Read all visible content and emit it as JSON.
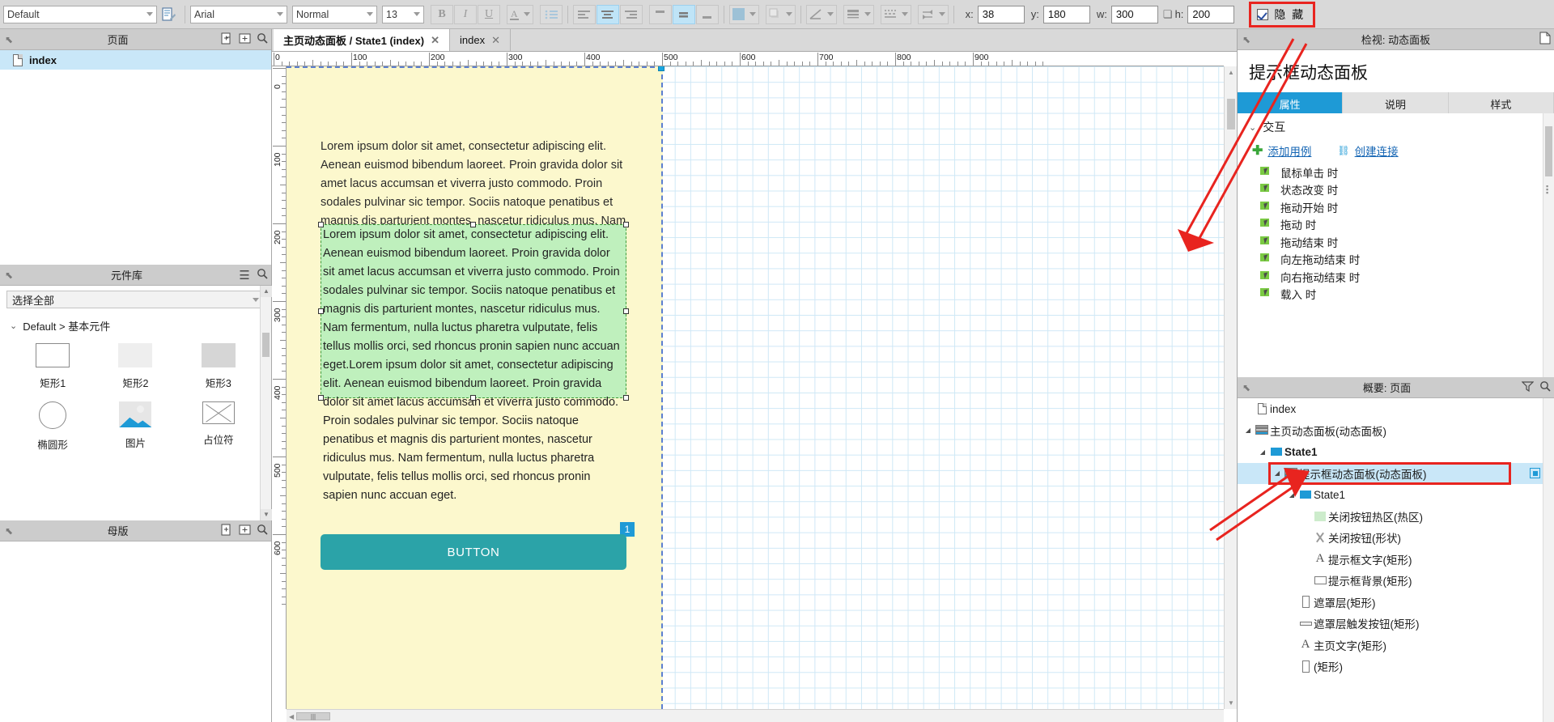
{
  "toolbar": {
    "style_select": "Default",
    "style_icon": "style-doc-icon",
    "font_select": "Arial",
    "weight_select": "Normal",
    "size_select": "13",
    "bold_label": "B",
    "italic_label": "I",
    "underline_label": "U",
    "font_color_label": "A",
    "bullet_icon": "bullet-list-icon",
    "align_left_icon": "align-left-icon",
    "align_center_icon": "align-center-icon",
    "align_right_icon": "align-right-icon",
    "valign_top_icon": "valign-top-icon",
    "valign_middle_icon": "valign-middle-icon",
    "valign_bottom_icon": "valign-bottom-icon",
    "fill_icon": "fill-color-icon",
    "shadow_icon": "shadow-icon",
    "line_icon": "line-style-icon",
    "line_width_icon": "line-width-icon",
    "dash_icon": "line-dash-icon",
    "arrow_icon": "arrow-style-icon",
    "x_label": "x:",
    "x_value": "38",
    "y_label": "y:",
    "y_value": "180",
    "w_label": "w:",
    "w_value": "300",
    "h_label": "h:",
    "h_value": "200",
    "lock_icon": "lock-aspect-icon",
    "hide_label": "隐 藏",
    "hide_checked": true,
    "accent_red": "#e8241f"
  },
  "pages_panel": {
    "title": "页面",
    "icons": [
      "add-page-icon",
      "add-folder-icon",
      "search-icon"
    ],
    "items": [
      {
        "label": "index",
        "icon": "page-file-icon",
        "selected": true
      }
    ]
  },
  "library_panel": {
    "title": "元件库",
    "icons": [
      "menu-icon",
      "search-icon"
    ],
    "selector_value": "选择全部",
    "group_label": "Default > 基本元件",
    "items": [
      {
        "label": "矩形1",
        "icon": "rectangle-outline-icon"
      },
      {
        "label": "矩形2",
        "icon": "rectangle-light-icon"
      },
      {
        "label": "矩形3",
        "icon": "rectangle-gray-icon"
      },
      {
        "label": "椭圆形",
        "icon": "ellipse-icon"
      },
      {
        "label": "图片",
        "icon": "image-icon"
      },
      {
        "label": "占位符",
        "icon": "placeholder-icon"
      }
    ]
  },
  "masters_panel": {
    "title": "母版",
    "icons": [
      "add-master-icon",
      "add-folder-icon",
      "search-icon"
    ]
  },
  "tabs": [
    {
      "label": "主页动态面板 / State1 (index)",
      "active": true,
      "closable": true,
      "close_label": "✕"
    },
    {
      "label": "index",
      "active": false,
      "closable": true,
      "close_label": "✕"
    }
  ],
  "canvas": {
    "h_ruler_labels": [
      "0",
      "100",
      "200",
      "300",
      "400",
      "500",
      "600",
      "700",
      "800",
      "900"
    ],
    "v_ruler_labels": [
      "0",
      "100",
      "200",
      "300",
      "400",
      "500",
      "600"
    ],
    "main_text": "Lorem ipsum dolor sit amet, consectetur adipiscing elit. Aenean euismod bibendum laoreet. Proin gravida dolor sit amet lacus accumsan et viverra justo commodo. Proin sodales pulvinar sic tempor. Sociis natoque penatibus et magnis dis parturient montes, nascetur ridiculus mus. Nam fermentum, nulla luctus pharetra vulputate, felis tellus mollis orci, sed rhoncus pronin sapien nunc accuan eget",
    "tip_text": "Lorem ipsum dolor sit amet, consectetur adipiscing elit. Aenean euismod bibendum laoreet. Proin gravida dolor sit amet lacus accumsan et viverra justo commodo. Proin sodales pulvinar sic tempor. Sociis natoque penatibus et magnis dis parturient montes, nascetur ridiculus mus. Nam fermentum, nulla luctus pharetra vulputate, felis tellus mollis orci, sed rhoncus pronin sapien nunc accuan eget.Lorem ipsum dolor sit amet, consectetur adipiscing elit. Aenean euismod bibendum laoreet. Proin gravida dolor sit amet lacus accumsan et viverra justo commodo. Proin sodales pulvinar sic tempor. Sociis natoque penatibus et magnis dis parturient montes, nascetur ridiculus mus. Nam fermentum, nulla luctus pharetra vulputate, felis tellus mollis orci, sed rhoncus pronin sapien nunc accuan eget.",
    "button_label": "BUTTON",
    "button_color": "#2ba3a8",
    "badge_label": "1",
    "page_bg": "#fcf8cd",
    "tip_bg": "#bff0bd"
  },
  "inspector": {
    "header_title": "检视: 动态面板",
    "header_icon": "page-note-icon",
    "object_name": "提示框动态面板",
    "tabs": [
      {
        "label": "属性",
        "active": true
      },
      {
        "label": "说明",
        "active": false
      },
      {
        "label": "样式",
        "active": false
      }
    ],
    "section_label": "交互",
    "add_case_label": "添加用例",
    "create_link_label": "创建连接",
    "events": [
      "鼠标单击 时",
      "状态改变 时",
      "拖动开始 时",
      "拖动 时",
      "拖动结束 时",
      "向左拖动结束 时",
      "向右拖动结束 时",
      "载入 时"
    ]
  },
  "outline": {
    "title": "概要: 页面",
    "icons": [
      "filter-icon",
      "search-icon"
    ],
    "rows": [
      {
        "indent": 0,
        "twisty": "",
        "icon": "page-file-icon",
        "label": "index",
        "type": "",
        "bold": false,
        "selected": false
      },
      {
        "indent": 0,
        "twisty": "◢",
        "icon": "dynamic-panel-icon",
        "label": "主页动态面板",
        "type": " (动态面板)",
        "bold": false,
        "selected": false
      },
      {
        "indent": 1,
        "twisty": "◢",
        "icon": "panel-state-icon",
        "label": "State1",
        "type": "",
        "bold": true,
        "selected": false
      },
      {
        "indent": 2,
        "twisty": "◢",
        "icon": "dynamic-panel-icon",
        "label": "提示框动态面板",
        "type": " (动态面板)",
        "bold": false,
        "selected": true,
        "highlight_box": true,
        "eye": true
      },
      {
        "indent": 3,
        "twisty": "◢",
        "icon": "panel-state-icon",
        "label": "State1",
        "type": "",
        "bold": false,
        "selected": false
      },
      {
        "indent": 4,
        "twisty": "",
        "icon": "hotspot-icon",
        "label": "关闭按钮热区",
        "type": " (热区)",
        "bold": false,
        "selected": false
      },
      {
        "indent": 4,
        "twisty": "",
        "icon": "shape-x-icon",
        "label": "关闭按钮",
        "type": " (形状)",
        "bold": false,
        "selected": false
      },
      {
        "indent": 4,
        "twisty": "",
        "icon": "text-a-icon",
        "label": "提示框文字",
        "type": " (矩形)",
        "bold": false,
        "selected": false
      },
      {
        "indent": 4,
        "twisty": "",
        "icon": "rect-icon",
        "label": "提示框背景",
        "type": " (矩形)",
        "bold": false,
        "selected": false
      },
      {
        "indent": 3,
        "twisty": "",
        "icon": "tall-rect-icon",
        "label": "遮罩层",
        "type": " (矩形)",
        "bold": false,
        "selected": false
      },
      {
        "indent": 3,
        "twisty": "",
        "icon": "bar-rect-icon",
        "label": "遮罩层触发按钮",
        "type": " (矩形)",
        "bold": false,
        "selected": false
      },
      {
        "indent": 3,
        "twisty": "",
        "icon": "text-a-icon",
        "label": "主页文字",
        "type": " (矩形)",
        "bold": false,
        "selected": false
      },
      {
        "indent": 3,
        "twisty": "",
        "icon": "tall-rect-icon",
        "label": "",
        "type": "(矩形)",
        "bold": false,
        "selected": false
      }
    ]
  }
}
